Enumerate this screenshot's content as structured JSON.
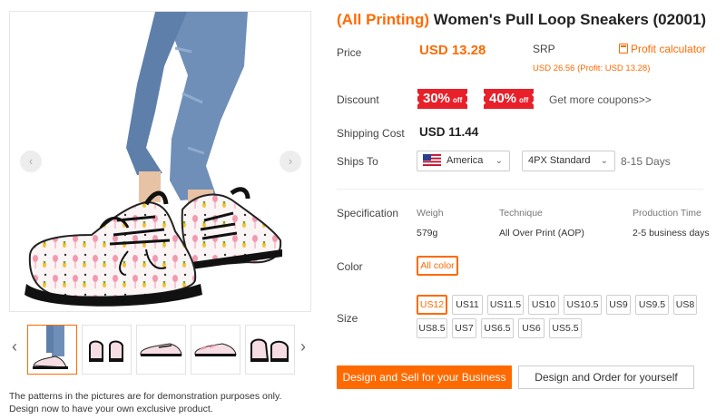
{
  "product": {
    "tag": "(All Printing)",
    "name": " Women's Pull Loop Sneakers (02001)"
  },
  "gallery": {
    "prev_arrow": "‹",
    "next_arrow": "›",
    "thumbs_prev": "‹",
    "thumbs_next": "›",
    "note_line1": "The patterns in the pictures are for demonstration purposes only.",
    "note_line2": "Design now to have your own exclusive product."
  },
  "price": {
    "label": "Price",
    "value": "USD 13.28",
    "srp_label": "SRP",
    "srp_detail": "USD 26.56 (Profit: USD 13.28)",
    "profit_calculator": "Profit calculator"
  },
  "discount": {
    "label": "Discount",
    "coupons": [
      {
        "pct": "30%",
        "off": "off"
      },
      {
        "pct": "40%",
        "off": "off"
      }
    ],
    "more_link": "Get more coupons>>"
  },
  "shipping": {
    "cost_label": "Shipping Cost",
    "cost_value": "USD 11.44",
    "ships_to_label": "Ships To",
    "country": "America",
    "method": "4PX Standard",
    "days": "8-15 Days"
  },
  "specification": {
    "label": "Specification",
    "headers": [
      "Weigh",
      "Technique",
      "Production Time"
    ],
    "values": [
      "579g",
      "All Over Print (AOP)",
      "2-5 business days"
    ]
  },
  "color": {
    "label": "Color",
    "selected": "All color"
  },
  "size": {
    "label": "Size",
    "options": [
      "US12",
      "US11",
      "US11.5",
      "US10",
      "US10.5",
      "US9",
      "US9.5",
      "US8",
      "US8.5",
      "US7",
      "US6.5",
      "US6",
      "US5.5"
    ],
    "selected": "US12"
  },
  "actions": {
    "primary": "Design and Sell for your Business",
    "secondary": "Design and Order for yourself"
  },
  "colors": {
    "accent": "#ff6a00",
    "coupon_red": "#e8202a",
    "jeans": "#6f8fb8",
    "sole": "#111111",
    "flamingo": "#f29ab0",
    "pineapple": "#f2c230"
  },
  "icons": {
    "calculator": "calculator-icon",
    "flag": "us-flag-icon",
    "chevron": "chevron-down-icon"
  }
}
